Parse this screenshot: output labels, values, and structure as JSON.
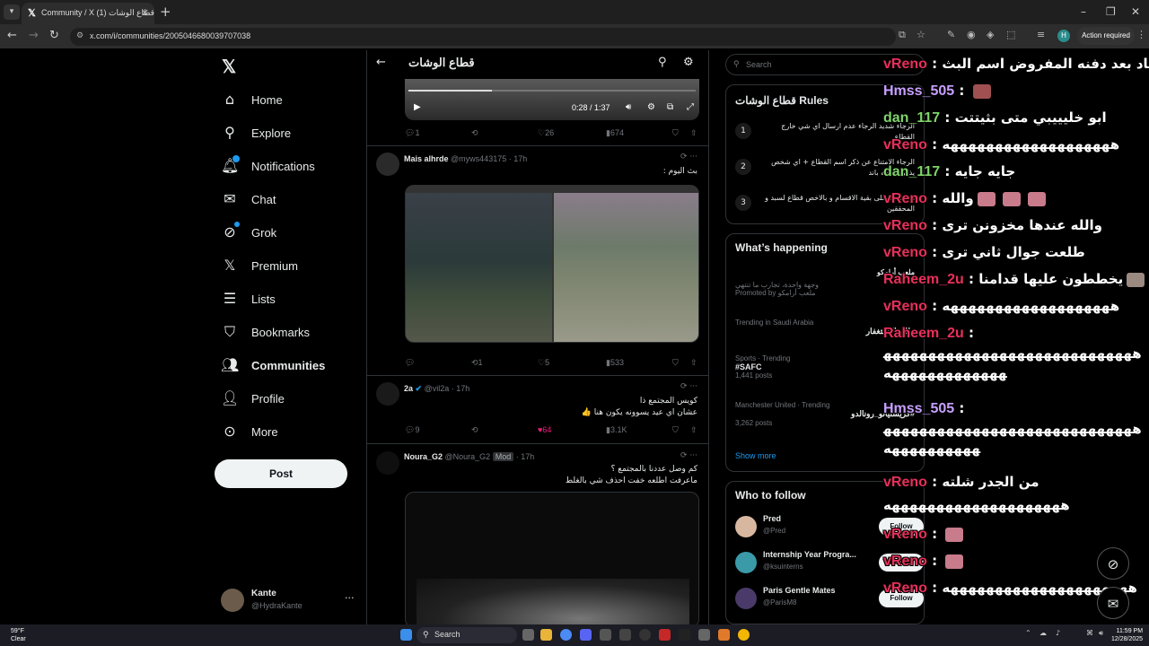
{
  "browser": {
    "tab_title": "Community / X قطاع الوشات (1)",
    "url": "x.com/i/communities/2005046680039707038",
    "action_required": "Action required",
    "profile_initial": "H"
  },
  "nav": {
    "items": [
      {
        "label": "Home"
      },
      {
        "label": "Explore"
      },
      {
        "label": "Notifications"
      },
      {
        "label": "Chat"
      },
      {
        "label": "Grok"
      },
      {
        "label": "Premium"
      },
      {
        "label": "Lists"
      },
      {
        "label": "Bookmarks"
      },
      {
        "label": "Communities"
      },
      {
        "label": "Profile"
      },
      {
        "label": "More"
      }
    ],
    "post_label": "Post",
    "account": {
      "name": "Kante",
      "handle": "@HydraKante"
    }
  },
  "feed": {
    "title": "قطاع الوشات",
    "video1": {
      "time": "0:28 / 1:37",
      "progress": 0.29
    },
    "post0_stats": {
      "replies": "1",
      "reposts": "",
      "likes": "26",
      "views": "674"
    },
    "posts": [
      {
        "name": "Mais alhrde",
        "handle": "@myws443175 · 17h",
        "text": "بث اليوم :",
        "stats": {
          "replies": "",
          "reposts": "1",
          "likes": "5",
          "views": "533"
        }
      },
      {
        "name": "2a",
        "handle": "@vil2a · 17h",
        "text": "كويس المجتمع ذا",
        "text2": "عشان اي عيد يسوونه يكون هنا 👍",
        "stats": {
          "replies": "9",
          "reposts": "",
          "likes": "64",
          "views": "3.1K"
        }
      },
      {
        "name": "Noura_G2",
        "handle": "@Noura_G2",
        "mod": "Mod",
        "time": "· 17h",
        "text": "كم وصل عددنا بالمجتمع ؟",
        "text2": "ماعرفت اطلعه خفت احذف شي بالغلط"
      }
    ]
  },
  "right": {
    "search_placeholder": "Search",
    "rules_title": "قطاع الوشات Rules",
    "rules": [
      {
        "num": "1",
        "text": "الرجاء شديد الرجاء عدم ارسال اي شي خارج القطاع"
      },
      {
        "num": "2",
        "text": "الرجاء الامتناع عن ذكر اسم القطاع + اي شخص يذكره بيجيه باند"
      },
      {
        "num": "3",
        "text": "التوكسك على بقية الاقسام و بالاخص قطاع لسبد و المحققين"
      }
    ],
    "happening_title": "What’s happening",
    "promo": {
      "name": "ملعب أرامكو",
      "text": "وجهة واحدة، تجارب ما تنتهي",
      "promoted": "Promoted by ملعب أرامكو"
    },
    "trends": [
      {
        "meta": "Trending in Saudi Arabia",
        "name": "ملك_الاستغفار",
        "posts": ""
      },
      {
        "meta": "Sports · Trending",
        "name": "#SAFC",
        "posts": "1,441 posts"
      },
      {
        "meta": "Manchester United · Trending",
        "name": "#كريستيانو_رونالدو",
        "posts": "3,262 posts"
      }
    ],
    "show_more": "Show more",
    "follow_title": "Who to follow",
    "follow": [
      {
        "name": "Pred",
        "handle": "@Pred",
        "btn": "Follow"
      },
      {
        "name": "Internship Year Progra...",
        "handle": "@ksuinterns",
        "btn": "Follow"
      },
      {
        "name": "Paris Gentle Mates",
        "handle": "@ParisM8",
        "btn": "Follow"
      }
    ]
  },
  "chat": [
    {
      "user": "vReno",
      "color": "#e8305a",
      "msg": "عاد بعد دفنه المفروض اسم البث"
    },
    {
      "user": "Hmss_505",
      "color": "#c8a0ff",
      "msg": ""
    },
    {
      "user": "dan_117",
      "color": "#7fd36a",
      "msg": "ابو خليييبي متى بثيتتت"
    },
    {
      "user": "vReno",
      "color": "#e8305a",
      "msg": "هههههههههههههههههههه"
    },
    {
      "user": "dan_117",
      "color": "#7fd36a",
      "msg": "جايه جايه"
    },
    {
      "user": "vReno",
      "color": "#e8305a",
      "msg": "والله"
    },
    {
      "user": "vReno",
      "color": "#e8305a",
      "msg": "والله عندها مخزونن ترى"
    },
    {
      "user": "vReno",
      "color": "#e8305a",
      "msg": "طلعت جوال ثاني ترى"
    },
    {
      "user": "Raheem_2u",
      "color": "#e8305a",
      "msg": "يخططون عليها قدامنا"
    },
    {
      "user": "vReno",
      "color": "#e8305a",
      "msg": "هههههههههههههههههههه"
    },
    {
      "user": "Raheem_2u",
      "color": "#e8305a",
      "msg": "ههههههههههههههههههههههههههههههههههههههههههه"
    },
    {
      "user": "Hmss_505",
      "color": "#c8a0ff",
      "msg": "هههههههههههههههههههههههههههههههههههههههه"
    },
    {
      "user": "vReno",
      "color": "#e8305a",
      "msg": "من الجدر شلته"
    },
    {
      "user": "",
      "color": "#ffffff",
      "msg": "ههههههههههههههههههههه"
    },
    {
      "user": "vReno",
      "color": "#e8305a",
      "msg": ""
    },
    {
      "user": "vReno",
      "color": "#e8305a",
      "msg": ""
    },
    {
      "user": "vReno",
      "color": "#e8305a",
      "msg": "هههههههههههههههههههههه"
    }
  ],
  "taskbar": {
    "weather_temp": "59°F",
    "weather_cond": "Clear",
    "search": "Search",
    "time": "11:59 PM",
    "date": "12/28/2025"
  }
}
